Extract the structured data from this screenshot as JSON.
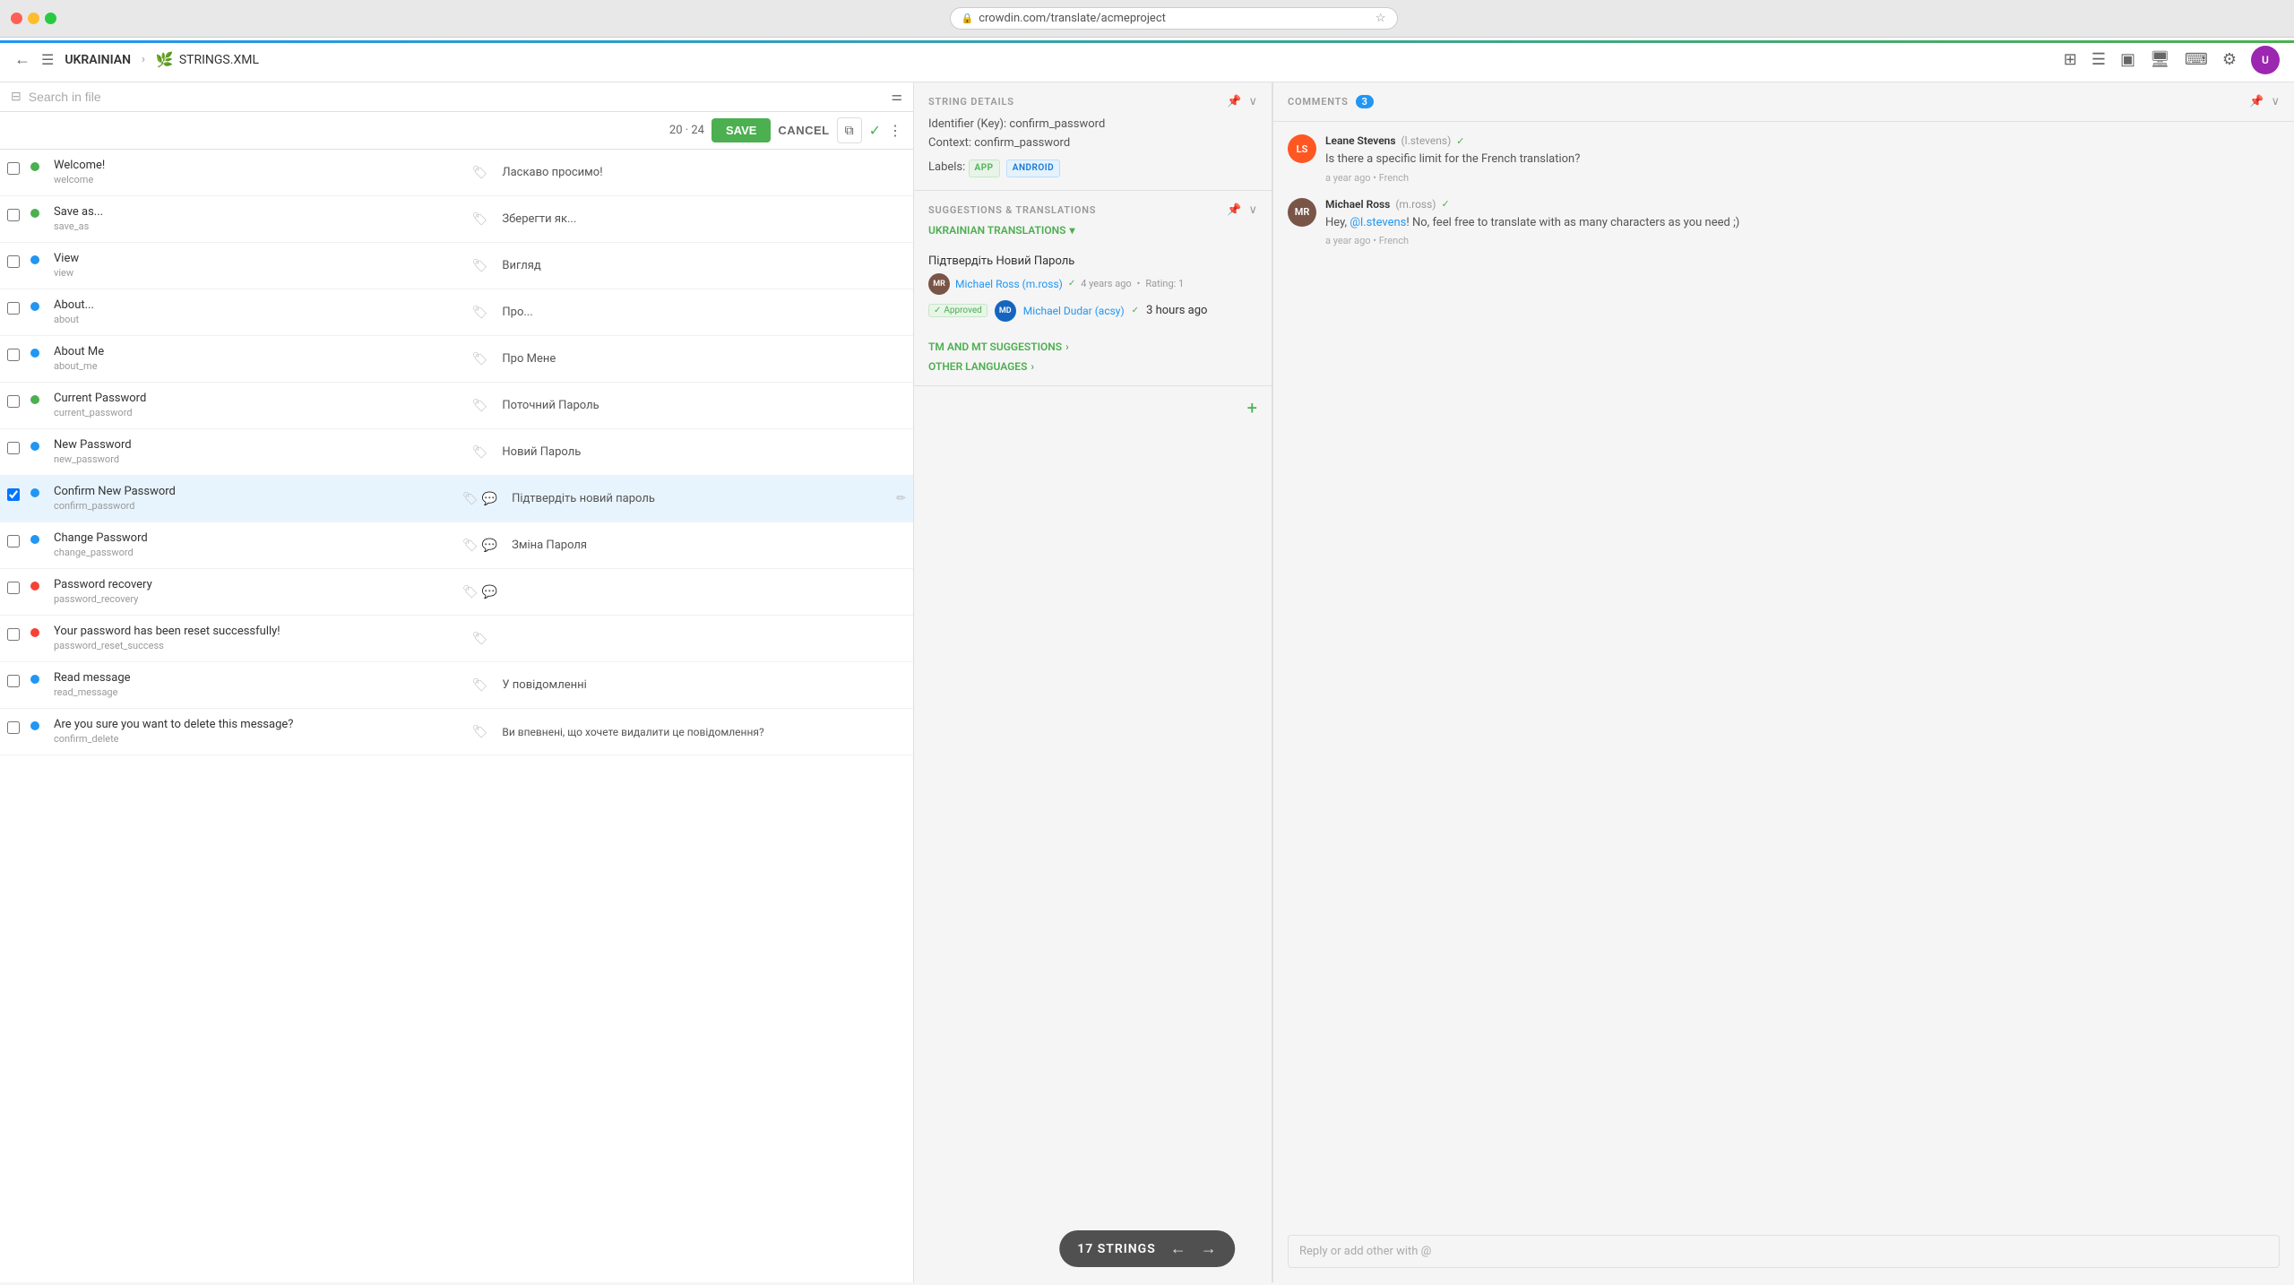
{
  "browser": {
    "url": "crowdin.com/translate/acmeproject",
    "traffic_lights": [
      "red",
      "yellow",
      "green"
    ]
  },
  "header": {
    "back_label": "←",
    "hamburger_label": "☰",
    "language": "UKRAINIAN",
    "separator": ">",
    "file_name": "STRINGS.XML",
    "tools": [
      "layout1",
      "layout2",
      "layout3",
      "monitor",
      "keyboard",
      "settings",
      "user"
    ]
  },
  "toolbar": {
    "search_placeholder": "Search in file",
    "counter": "20 · 24",
    "save_label": "SAVE",
    "cancel_label": "CANCEL",
    "copy_icon": "⧉",
    "check_icon": "✓",
    "more_icon": "⋮"
  },
  "strings": [
    {
      "id": 1,
      "checked": false,
      "status": "green",
      "source": "Welcome!",
      "key": "welcome",
      "translation": "Ласкаво просимо!",
      "has_tag": true,
      "has_comment": false
    },
    {
      "id": 2,
      "checked": false,
      "status": "green",
      "source": "Save as...",
      "key": "save_as",
      "translation": "Зберегти як...",
      "has_tag": true,
      "has_comment": false
    },
    {
      "id": 3,
      "checked": false,
      "status": "blue",
      "source": "View",
      "key": "view",
      "translation": "Вигляд",
      "has_tag": true,
      "has_comment": false
    },
    {
      "id": 4,
      "checked": false,
      "status": "blue",
      "source": "About...",
      "key": "about",
      "translation": "Про...",
      "has_tag": true,
      "has_comment": false
    },
    {
      "id": 5,
      "checked": false,
      "status": "blue",
      "source": "About Me",
      "key": "about_me",
      "translation": "Про Мене",
      "has_tag": true,
      "has_comment": false
    },
    {
      "id": 6,
      "checked": false,
      "status": "green",
      "source": "Current Password",
      "key": "current_password",
      "translation": "Поточний Пароль",
      "has_tag": true,
      "has_comment": false
    },
    {
      "id": 7,
      "checked": false,
      "status": "blue",
      "source": "New Password",
      "key": "new_password",
      "translation": "Новий Пароль",
      "has_tag": true,
      "has_comment": false
    },
    {
      "id": 8,
      "checked": true,
      "status": "selected",
      "source": "Confirm New Password",
      "key": "confirm_password",
      "translation": "Підтвердіть новий пароль",
      "has_tag": true,
      "has_comment": true,
      "selected": true
    },
    {
      "id": 9,
      "checked": false,
      "status": "blue",
      "source": "Change Password",
      "key": "change_password",
      "translation": "Зміна Пароля",
      "has_tag": true,
      "has_comment": true
    },
    {
      "id": 10,
      "checked": false,
      "status": "red",
      "source": "Password recovery",
      "key": "password_recovery",
      "translation": "",
      "has_tag": true,
      "has_comment": true
    },
    {
      "id": 11,
      "checked": false,
      "status": "red",
      "source": "Your password has been reset successfully!",
      "key": "password_reset_success",
      "translation": "",
      "has_tag": true,
      "has_comment": false
    },
    {
      "id": 12,
      "checked": false,
      "status": "blue",
      "source": "Read message",
      "key": "read_message",
      "translation": "У повідомленні",
      "has_tag": true,
      "has_comment": false
    },
    {
      "id": 13,
      "checked": false,
      "status": "blue",
      "source": "Are you sure you want to delete this message?",
      "key": "confirm_delete",
      "translation": "Ви впевнені, що хочете видалити це повідомлення?",
      "has_tag": true,
      "has_comment": false
    }
  ],
  "string_details": {
    "title": "STRING DETAILS",
    "identifier_label": "Identifier (Key):",
    "identifier_value": "confirm_password",
    "context_label": "Context:",
    "context_value": "confirm_password",
    "labels_label": "Labels:",
    "labels": [
      "APP",
      "ANDROID"
    ]
  },
  "suggestions": {
    "title": "SUGGESTIONS & TRANSLATIONS",
    "ukrainian_translations_label": "UKRAINIAN TRANSLATIONS",
    "items": [
      {
        "text": "Підтвердіть Новий Пароль",
        "user": "Michael Ross",
        "handle": "m.ross",
        "verified": true,
        "time_ago": "4 years ago",
        "rating": "Rating: 1",
        "approved": true,
        "approved_by": "Michael Dudar (acsy)",
        "approved_verified": true,
        "approved_time": "3 hours ago"
      }
    ],
    "tm_mt_label": "TM AND MT SUGGESTIONS",
    "other_languages_label": "OTHER LANGUAGES"
  },
  "comments": {
    "title": "COMMENTS",
    "count": "3",
    "items": [
      {
        "id": 1,
        "user": "Leane Stevens",
        "handle": "l.stevens",
        "verified": true,
        "avatar_initials": "LS",
        "avatar_color": "#FF5722",
        "text": "Is there a specific limit for the French translation?",
        "time_ago": "a year ago",
        "language": "French"
      },
      {
        "id": 2,
        "user": "Michael Ross",
        "handle": "m.ross",
        "verified": true,
        "avatar_initials": "MR",
        "avatar_color": "#795548",
        "text_parts": [
          "Hey, ",
          "@l.stevens",
          "! No, feel free to translate with as many characters as you need ;)"
        ],
        "time_ago": "a year ago",
        "language": "French"
      }
    ],
    "reply_placeholder": "Reply or add other with @"
  },
  "bottom_overlay": {
    "label": "17 STRINGS",
    "prev_arrow": "←",
    "next_arrow": "→"
  }
}
